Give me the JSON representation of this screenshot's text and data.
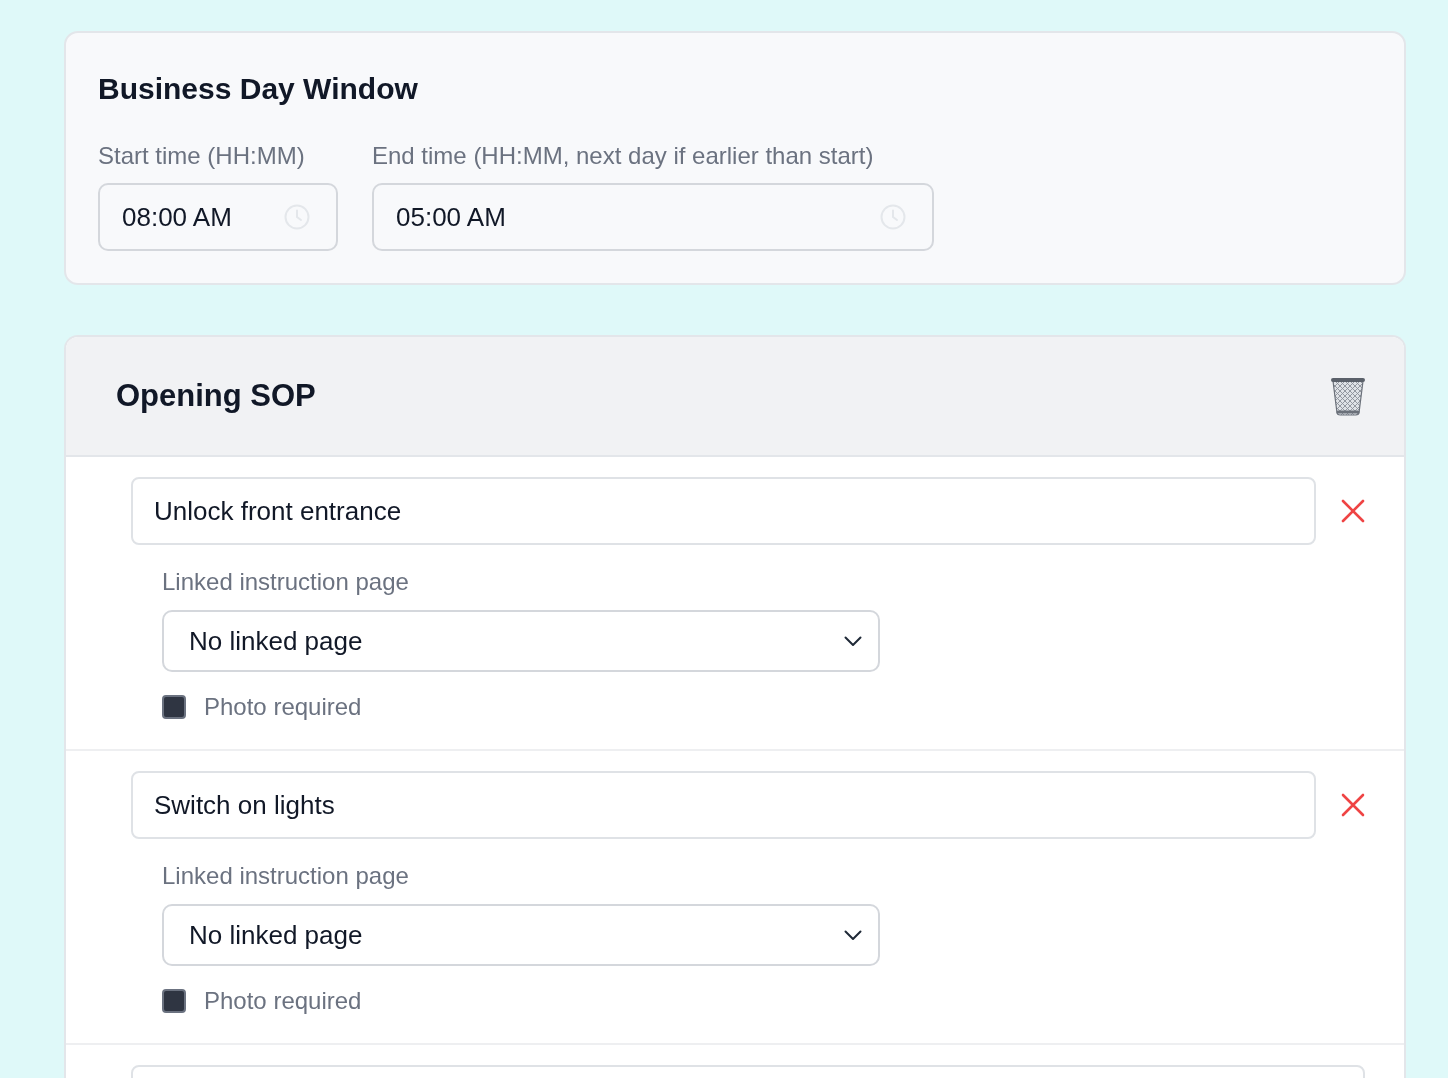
{
  "business_day_window": {
    "title": "Business Day Window",
    "start_time": {
      "label": "Start time (HH:MM)",
      "value": "08:00 AM"
    },
    "end_time": {
      "label": "End time (HH:MM, next day if earlier than start)",
      "value": "05:00 AM"
    }
  },
  "sop_sections": [
    {
      "title": "Opening SOP",
      "tasks": [
        {
          "text": "Unlock front entrance",
          "link_label": "Linked instruction page",
          "linked_page": "No linked page",
          "photo_label": "Photo required",
          "photo_required": false
        },
        {
          "text": "Switch on lights",
          "link_label": "Linked instruction page",
          "linked_page": "No linked page",
          "photo_label": "Photo required",
          "photo_required": false
        },
        {
          "kind": "cut_off"
        }
      ]
    }
  ]
}
